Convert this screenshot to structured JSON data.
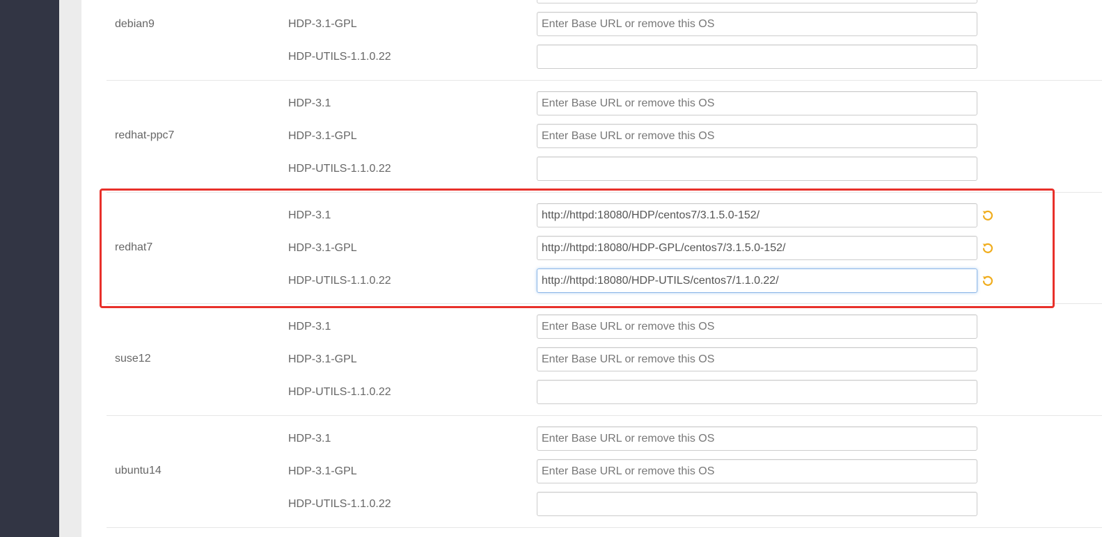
{
  "colors": {
    "sidebar": "#323544",
    "highlight": "#e8302a",
    "revert_icon": "#f0ad1e"
  },
  "placeholder_text": "Enter Base URL or remove this OS",
  "os_groups": [
    {
      "os": "debian9",
      "repos": [
        {
          "name": "HDP-3.1-GPL",
          "value": "",
          "placeholder": "Enter Base URL or remove this OS"
        },
        {
          "name": "HDP-UTILS-1.1.0.22",
          "value": "",
          "placeholder": ""
        }
      ]
    },
    {
      "os": "redhat-ppc7",
      "repos": [
        {
          "name": "HDP-3.1",
          "value": "",
          "placeholder": "Enter Base URL or remove this OS"
        },
        {
          "name": "HDP-3.1-GPL",
          "value": "",
          "placeholder": "Enter Base URL or remove this OS"
        },
        {
          "name": "HDP-UTILS-1.1.0.22",
          "value": "",
          "placeholder": ""
        }
      ]
    },
    {
      "os": "redhat7",
      "repos": [
        {
          "name": "HDP-3.1",
          "value": "http://httpd:18080/HDP/centos7/3.1.5.0-152/",
          "placeholder": ""
        },
        {
          "name": "HDP-3.1-GPL",
          "value": "http://httpd:18080/HDP-GPL/centos7/3.1.5.0-152/",
          "placeholder": ""
        },
        {
          "name": "HDP-UTILS-1.1.0.22",
          "value": "http://httpd:18080/HDP-UTILS/centos7/1.1.0.22/",
          "placeholder": ""
        }
      ]
    },
    {
      "os": "suse12",
      "repos": [
        {
          "name": "HDP-3.1",
          "value": "",
          "placeholder": "Enter Base URL or remove this OS"
        },
        {
          "name": "HDP-3.1-GPL",
          "value": "",
          "placeholder": "Enter Base URL or remove this OS"
        },
        {
          "name": "HDP-UTILS-1.1.0.22",
          "value": "",
          "placeholder": ""
        }
      ]
    },
    {
      "os": "ubuntu14",
      "repos": [
        {
          "name": "HDP-3.1",
          "value": "",
          "placeholder": "Enter Base URL or remove this OS"
        },
        {
          "name": "HDP-3.1-GPL",
          "value": "",
          "placeholder": "Enter Base URL or remove this OS"
        },
        {
          "name": "HDP-UTILS-1.1.0.22",
          "value": "",
          "placeholder": ""
        }
      ]
    }
  ]
}
